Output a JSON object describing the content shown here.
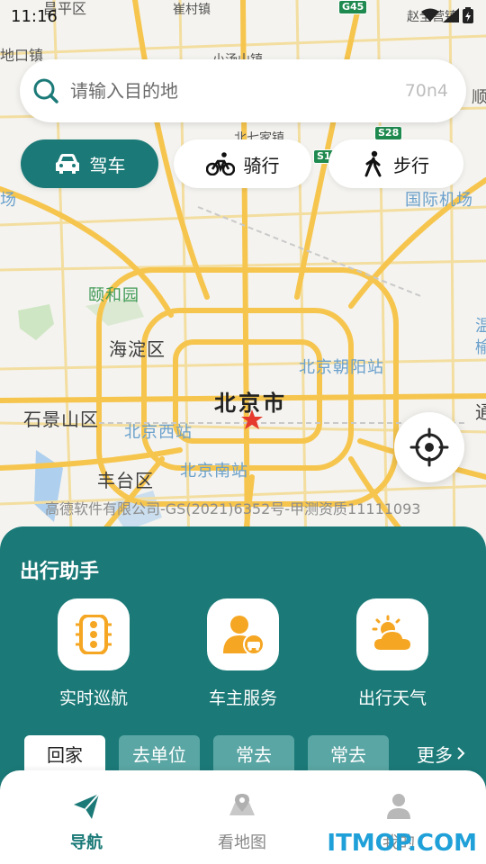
{
  "status_bar": {
    "time": "11:16"
  },
  "search": {
    "placeholder": "请输入目的地",
    "tail_text": "70n4"
  },
  "modes": [
    {
      "label": "驾车",
      "icon": "car-icon",
      "active": true
    },
    {
      "label": "骑行",
      "icon": "bicycle-icon",
      "active": false
    },
    {
      "label": "步行",
      "icon": "walk-icon",
      "active": false
    }
  ],
  "map": {
    "city": "北京市",
    "districts": [
      "海淀区",
      "石景山区",
      "丰台区"
    ],
    "park": "颐和园",
    "stations": [
      "北京西站",
      "北京南站",
      "北京朝阳站"
    ],
    "airport": "国际机场",
    "towns": [
      "崔村镇",
      "小汤山镇",
      "北七家镇",
      "赵全营镇"
    ],
    "edge_labels": [
      "昌平区",
      "地口镇",
      "场",
      "顺",
      "温",
      "榆",
      "通"
    ],
    "shields": [
      "G45",
      "S28",
      "S1"
    ],
    "copyright": "高德软件有限公司-GS(2021)6352号-甲测资质11111093",
    "colors": {
      "road_major": "#f6c54e",
      "road_minor": "#f3dea0",
      "water": "#aed0ee",
      "park": "#cfe6c4"
    }
  },
  "assistant": {
    "title": "出行助手",
    "services": [
      {
        "label": "实时巡航",
        "icon": "traffic-light-icon"
      },
      {
        "label": "车主服务",
        "icon": "car-owner-icon"
      },
      {
        "label": "出行天气",
        "icon": "weather-icon"
      }
    ],
    "chips": [
      "回家",
      "去单位",
      "常去",
      "常去"
    ],
    "more": "更多"
  },
  "nav": [
    {
      "label": "导航",
      "icon": "paper-plane-icon",
      "active": true
    },
    {
      "label": "看地图",
      "icon": "map-pin-icon",
      "active": false
    },
    {
      "label": "我的",
      "icon": "user-icon",
      "active": false
    }
  ],
  "watermark": "ITMOP.COM",
  "theme": {
    "accent": "#1b7a78",
    "accent_light": "#5aa6a4",
    "icon_orange": "#f5a623"
  }
}
